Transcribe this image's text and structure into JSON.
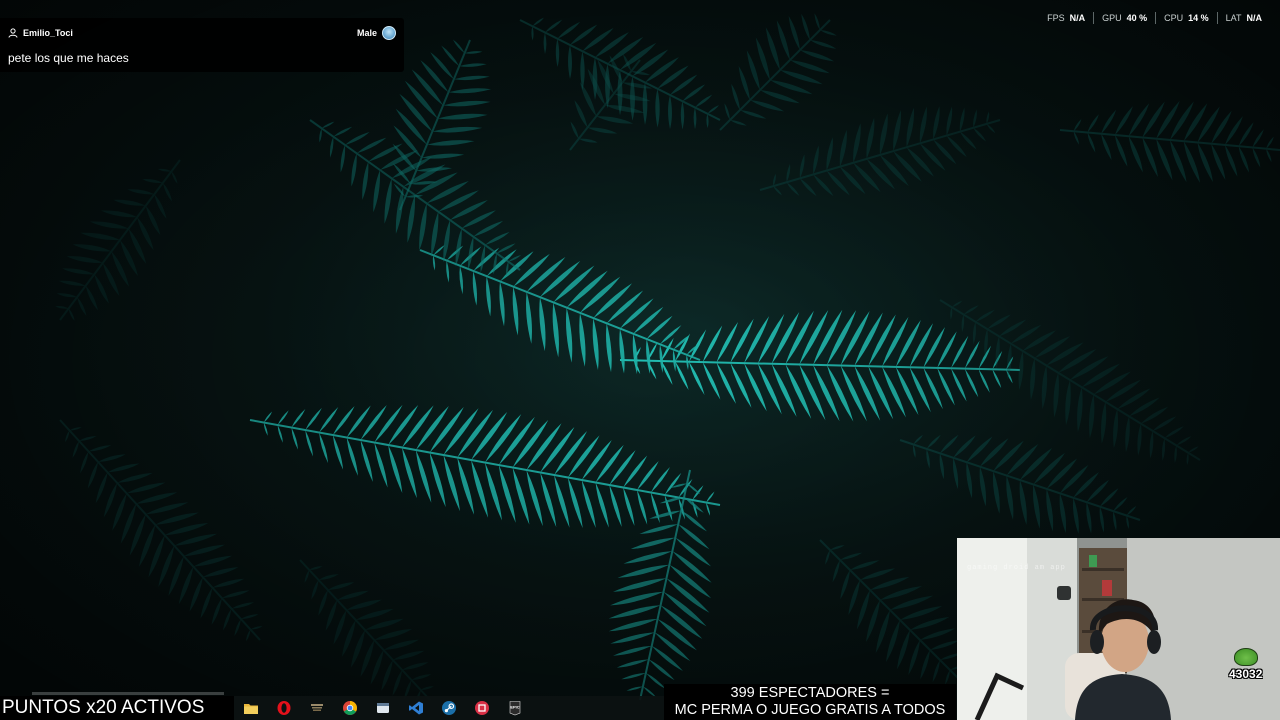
{
  "chat": {
    "username": "Emilio_Toci",
    "gender": "Male",
    "message": "pete los que me haces"
  },
  "hud": {
    "fps_label": "FPS",
    "fps_value": "N/A",
    "gpu_label": "GPU",
    "gpu_value": "40 %",
    "cpu_label": "CPU",
    "cpu_value": "14 %",
    "lat_label": "LAT",
    "lat_value": "N/A"
  },
  "stream": {
    "puntos_banner": "PUNTOS x20 ACTIVOS",
    "espectadores_line1": "399 ESPECTADORES =",
    "espectadores_line2": "MC PERMA O JUEGO GRATIS A TODOS"
  },
  "webcam": {
    "watermark": "gaming droid am app",
    "badge_count": "43032"
  },
  "taskbar": {
    "items": [
      {
        "icon": "file-explorer-icon",
        "label": "File Explorer"
      },
      {
        "icon": "opera-icon",
        "label": "Opera"
      },
      {
        "icon": "league-of-legends-icon",
        "label": "League of Legends"
      },
      {
        "icon": "chrome-icon",
        "label": "Google Chrome"
      },
      {
        "icon": "app-window-icon",
        "label": "App"
      },
      {
        "icon": "visual-studio-icon",
        "label": "Visual Studio"
      },
      {
        "icon": "steam-icon",
        "label": "Steam"
      },
      {
        "icon": "red-app-icon",
        "label": "App"
      },
      {
        "icon": "epic-games-icon",
        "label": "EPIC"
      }
    ]
  },
  "colors": {
    "fern": "#1fb8ae",
    "fern_dark": "#0f5f5a",
    "background": "#06100f",
    "banner_bg": "#000000",
    "banner_text": "#ffffff"
  }
}
